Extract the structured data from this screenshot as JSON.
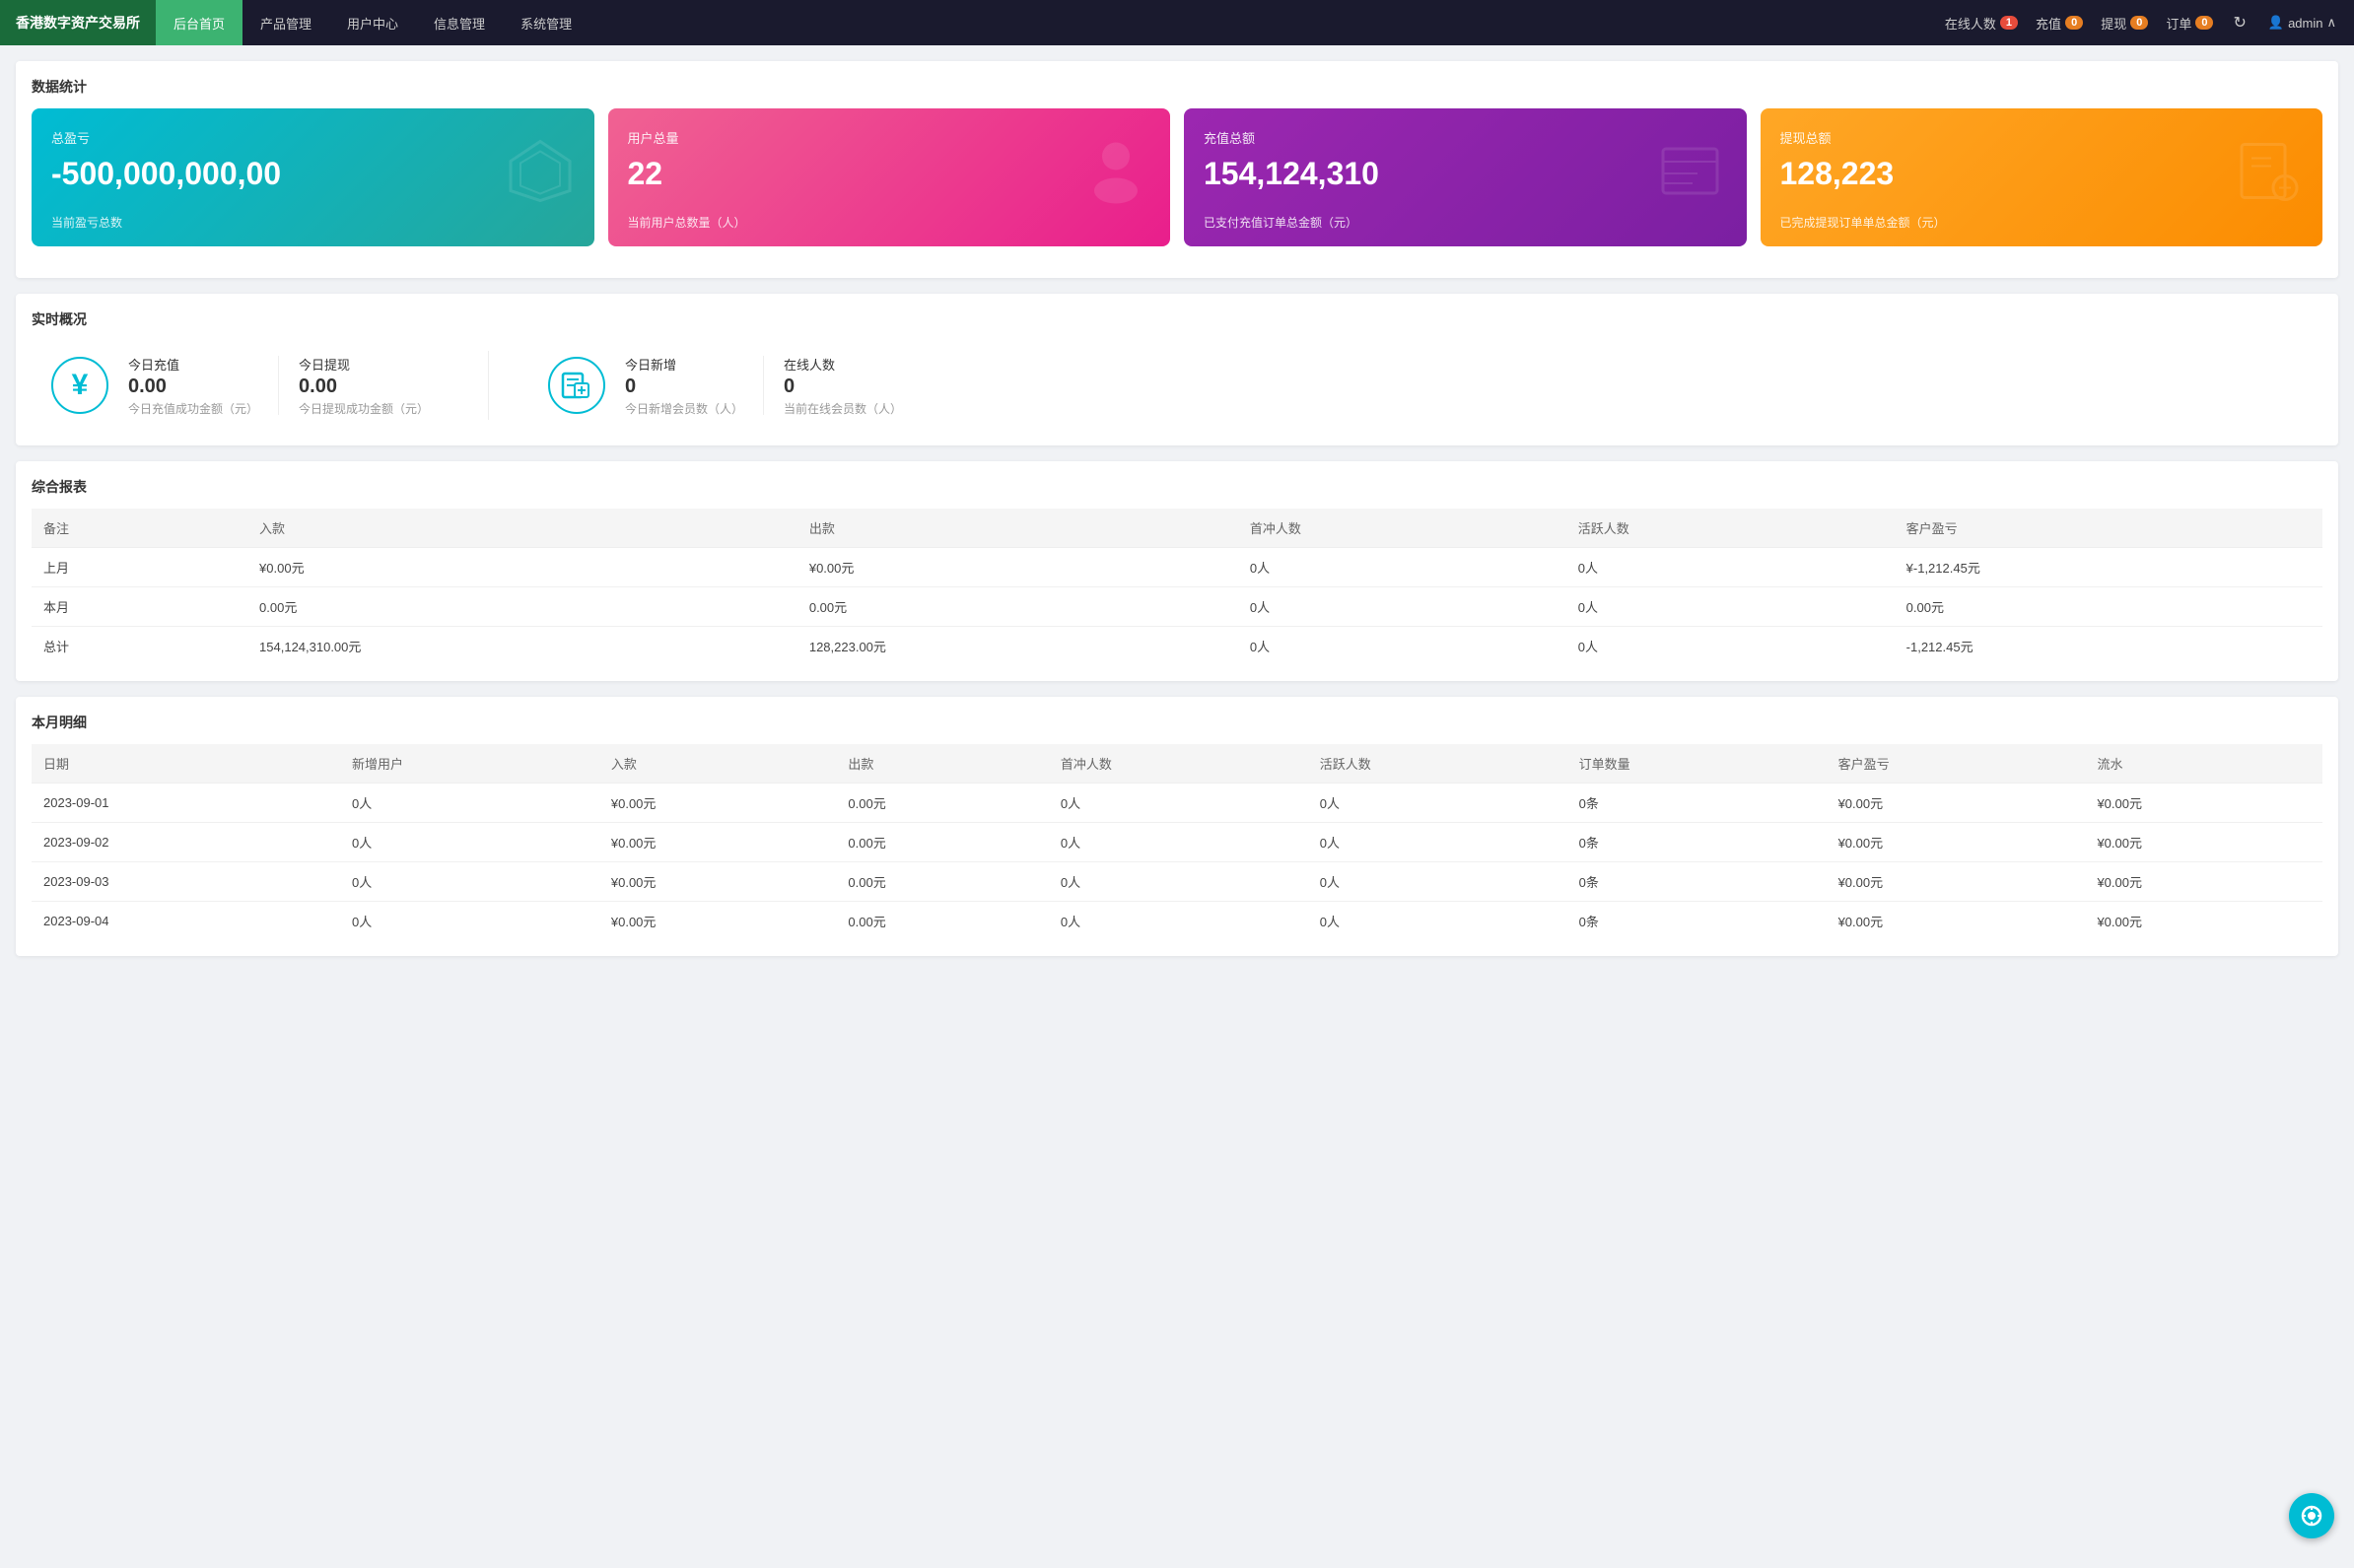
{
  "nav": {
    "logo": "香港数字资产交易所",
    "items": [
      {
        "label": "后台首页",
        "active": true
      },
      {
        "label": "产品管理",
        "active": false
      },
      {
        "label": "用户中心",
        "active": false
      },
      {
        "label": "信息管理",
        "active": false
      },
      {
        "label": "系统管理",
        "active": false
      }
    ],
    "right": {
      "online_label": "在线人数",
      "online_count": "1",
      "recharge_label": "充值",
      "recharge_count": "0",
      "withdraw_label": "提现",
      "withdraw_count": "0",
      "order_label": "订单",
      "order_count": "0",
      "admin_label": "admin"
    }
  },
  "stats_section_title": "数据统计",
  "stat_cards": [
    {
      "label": "总盈亏",
      "value": "-500,000,000,00",
      "sub": "当前盈亏总数",
      "type": "cyan",
      "icon": "◇"
    },
    {
      "label": "用户总量",
      "value": "22",
      "sub": "当前用户总数量（人）",
      "type": "pink",
      "icon": "👤"
    },
    {
      "label": "充值总额",
      "value": "154,124,310",
      "sub": "已支付充值订单总金额（元）",
      "type": "purple",
      "icon": "📖"
    },
    {
      "label": "提现总额",
      "value": "128,223",
      "sub": "已完成提现订单单总金额（元）",
      "type": "orange",
      "icon": "?"
    }
  ],
  "realtime_section_title": "实时概况",
  "realtime": {
    "recharge_label": "今日充值",
    "recharge_value": "0.00",
    "recharge_sub": "今日充值成功金额（元）",
    "withdraw_label": "今日提现",
    "withdraw_value": "0.00",
    "withdraw_sub": "今日提现成功金额（元）",
    "new_users_label": "今日新增",
    "new_users_value": "0",
    "new_users_sub": "今日新增会员数（人）",
    "online_label": "在线人数",
    "online_value": "0",
    "online_sub": "当前在线会员数（人）"
  },
  "report_section_title": "综合报表",
  "report_headers": [
    "备注",
    "入款",
    "出款",
    "首冲人数",
    "活跃人数",
    "客户盈亏"
  ],
  "report_rows": [
    {
      "note": "上月",
      "income": "¥0.00元",
      "outcome": "¥0.00元",
      "first_deposit": "0人",
      "active": "0人",
      "profit": "¥-1,212.45元"
    },
    {
      "note": "本月",
      "income": "0.00元",
      "outcome": "0.00元",
      "first_deposit": "0人",
      "active": "0人",
      "profit": "0.00元"
    },
    {
      "note": "总计",
      "income": "154,124,310.00元",
      "outcome": "128,223.00元",
      "first_deposit": "0人",
      "active": "0人",
      "profit": "-1,212.45元"
    }
  ],
  "monthly_section_title": "本月明细",
  "monthly_headers": [
    "日期",
    "新增用户",
    "入款",
    "出款",
    "首冲人数",
    "活跃人数",
    "订单数量",
    "客户盈亏",
    "流水"
  ],
  "monthly_rows": [
    {
      "date": "2023-09-01",
      "new_users": "0人",
      "income": "¥0.00元",
      "outcome": "0.00元",
      "first": "0人",
      "active": "0人",
      "orders": "0条",
      "profit": "¥0.00元",
      "flow": "¥0.00元"
    },
    {
      "date": "2023-09-02",
      "new_users": "0人",
      "income": "¥0.00元",
      "outcome": "0.00元",
      "first": "0人",
      "active": "0人",
      "orders": "0条",
      "profit": "¥0.00元",
      "flow": "¥0.00元"
    },
    {
      "date": "2023-09-03",
      "new_users": "0人",
      "income": "¥0.00元",
      "outcome": "0.00元",
      "first": "0人",
      "active": "0人",
      "orders": "0条",
      "profit": "¥0.00元",
      "flow": "¥0.00元"
    },
    {
      "date": "2023-09-04",
      "new_users": "0人",
      "income": "¥0.00元",
      "outcome": "0.00元",
      "first": "0人",
      "active": "0人",
      "orders": "0条",
      "profit": "¥0.00元",
      "flow": "¥0.00元"
    }
  ]
}
